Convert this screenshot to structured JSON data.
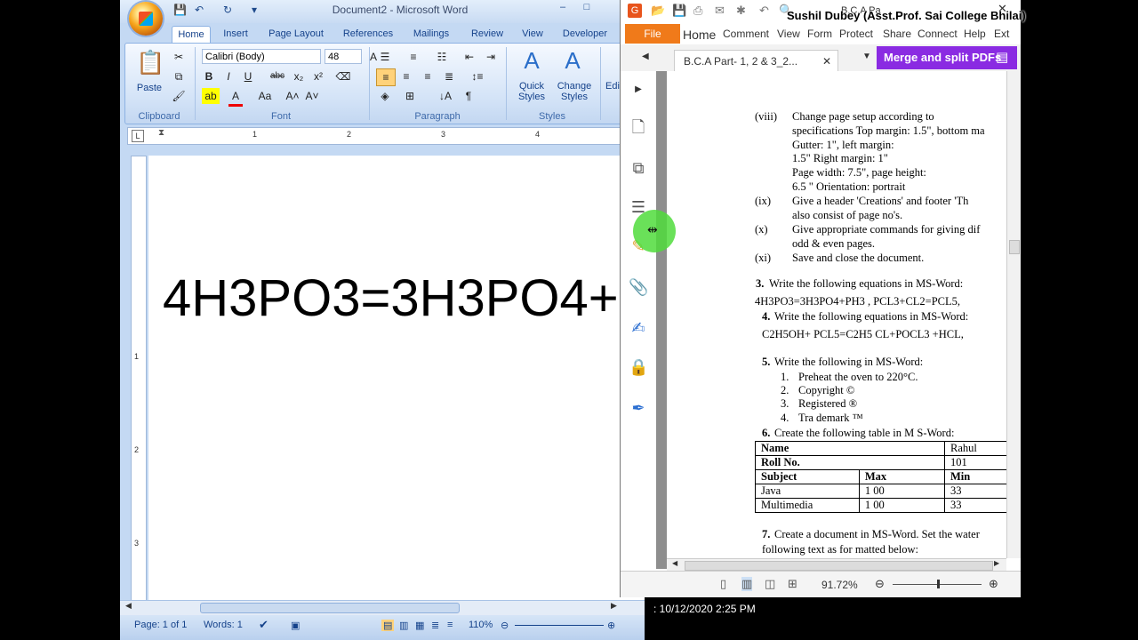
{
  "word": {
    "title": "Document2 - Microsoft Word",
    "tabs": [
      "Home",
      "Insert",
      "Page Layout",
      "References",
      "Mailings",
      "Review",
      "View",
      "Developer"
    ],
    "ribbon": {
      "clipboard_label": "Clipboard",
      "paste_label": "Paste",
      "font_label": "Font",
      "font_name": "Calibri (Body)",
      "font_size": "48",
      "paragraph_label": "Paragraph",
      "styles_label": "Styles",
      "quick_styles_1": "Quick",
      "quick_styles_2": "Styles",
      "change_styles_1": "Change",
      "change_styles_2": "Styles",
      "editing_label": "Editi"
    },
    "document_text": "4H3PO3=3H3PO4+",
    "status": {
      "page": "Page: 1 of 1",
      "words": "Words: 1",
      "zoom": "110%"
    },
    "ruler_numbers": [
      "1",
      "2",
      "3",
      "4"
    ],
    "vruler_numbers": [
      "1",
      "2",
      "3"
    ]
  },
  "pdf": {
    "doc_title_partial": "B.C.A Pa",
    "menu": {
      "file": "File",
      "items": [
        "Home",
        "Comment",
        "View",
        "Form",
        "Protect",
        "Share",
        "Connect",
        "Help",
        "Ext"
      ]
    },
    "tab_title": "B.C.A Part- 1, 2 & 3_2...",
    "merge_button": "Merge and split PDFs",
    "zoom": "91.72%",
    "content": {
      "viii_num": "(viii)",
      "viii_l1": "Change   page   setup   according   to",
      "viii_l2": "specifications Top margin: 1.5\", bottom ma",
      "viii_l3": "Gutter:  1\",   left   margin:",
      "viii_l4": "1.5\" Right margin: 1\"",
      "viii_l5": "Page  width:  7.5\",  page  height:",
      "viii_l6": "6.5 \" Orientation: portrait",
      "ix_num": "(ix)",
      "ix_l1": "Give  a  header  'Creations'  and  footer  'Th",
      "ix_l2": "also consist of page no's.",
      "x_num": "(x)",
      "x_l1": "Give  appropriate  commands  for  giving  dif",
      "x_l2": "odd & even pages.",
      "xi_num": "(xi)",
      "xi_l1": "Save and close the document.",
      "q3_num": "3.",
      "q3": "Write the following equations in MS-Word:",
      "q3_eq": "4H3PO3=3H3PO4+PH3 ,     PCL3+CL2=PCL5,",
      "q4_num": "4.",
      "q4": "Write the following equations in MS-Word:",
      "q4_eq": "C2H5OH+ PCL5=C2H5 CL+POCL3 +HCL,",
      "q5_num": "5.",
      "q5": "Write the following in MS-Word:",
      "q5_items": [
        {
          "n": "1.",
          "t": "Preheat the oven to 220°C."
        },
        {
          "n": "2.",
          "t": "Copyright        ©"
        },
        {
          "n": "3.",
          "t": "Registered        ®"
        },
        {
          "n": "4.",
          "t": "Tra demark      ™"
        }
      ],
      "q6_num": "6.",
      "q6": "Create the following table in M S-Word:",
      "table": [
        [
          "Name",
          "",
          "Rahul"
        ],
        [
          "Roll No.",
          "",
          "101"
        ],
        [
          "Subject",
          "Max",
          "Min"
        ],
        [
          "Java",
          "1 00",
          "33"
        ],
        [
          "Multimedia",
          "1 00",
          "33"
        ]
      ],
      "q7_num": "7.",
      "q7": "Create a document in MS-Word. Set the water",
      "q7_l2": "following text as for matted below:"
    }
  },
  "overlay": {
    "presenter": "Sushil Dubey (Asst.Prof. Sai College Bhilai)",
    "timestamp": ": 10/12/2020 2:25 PM"
  }
}
